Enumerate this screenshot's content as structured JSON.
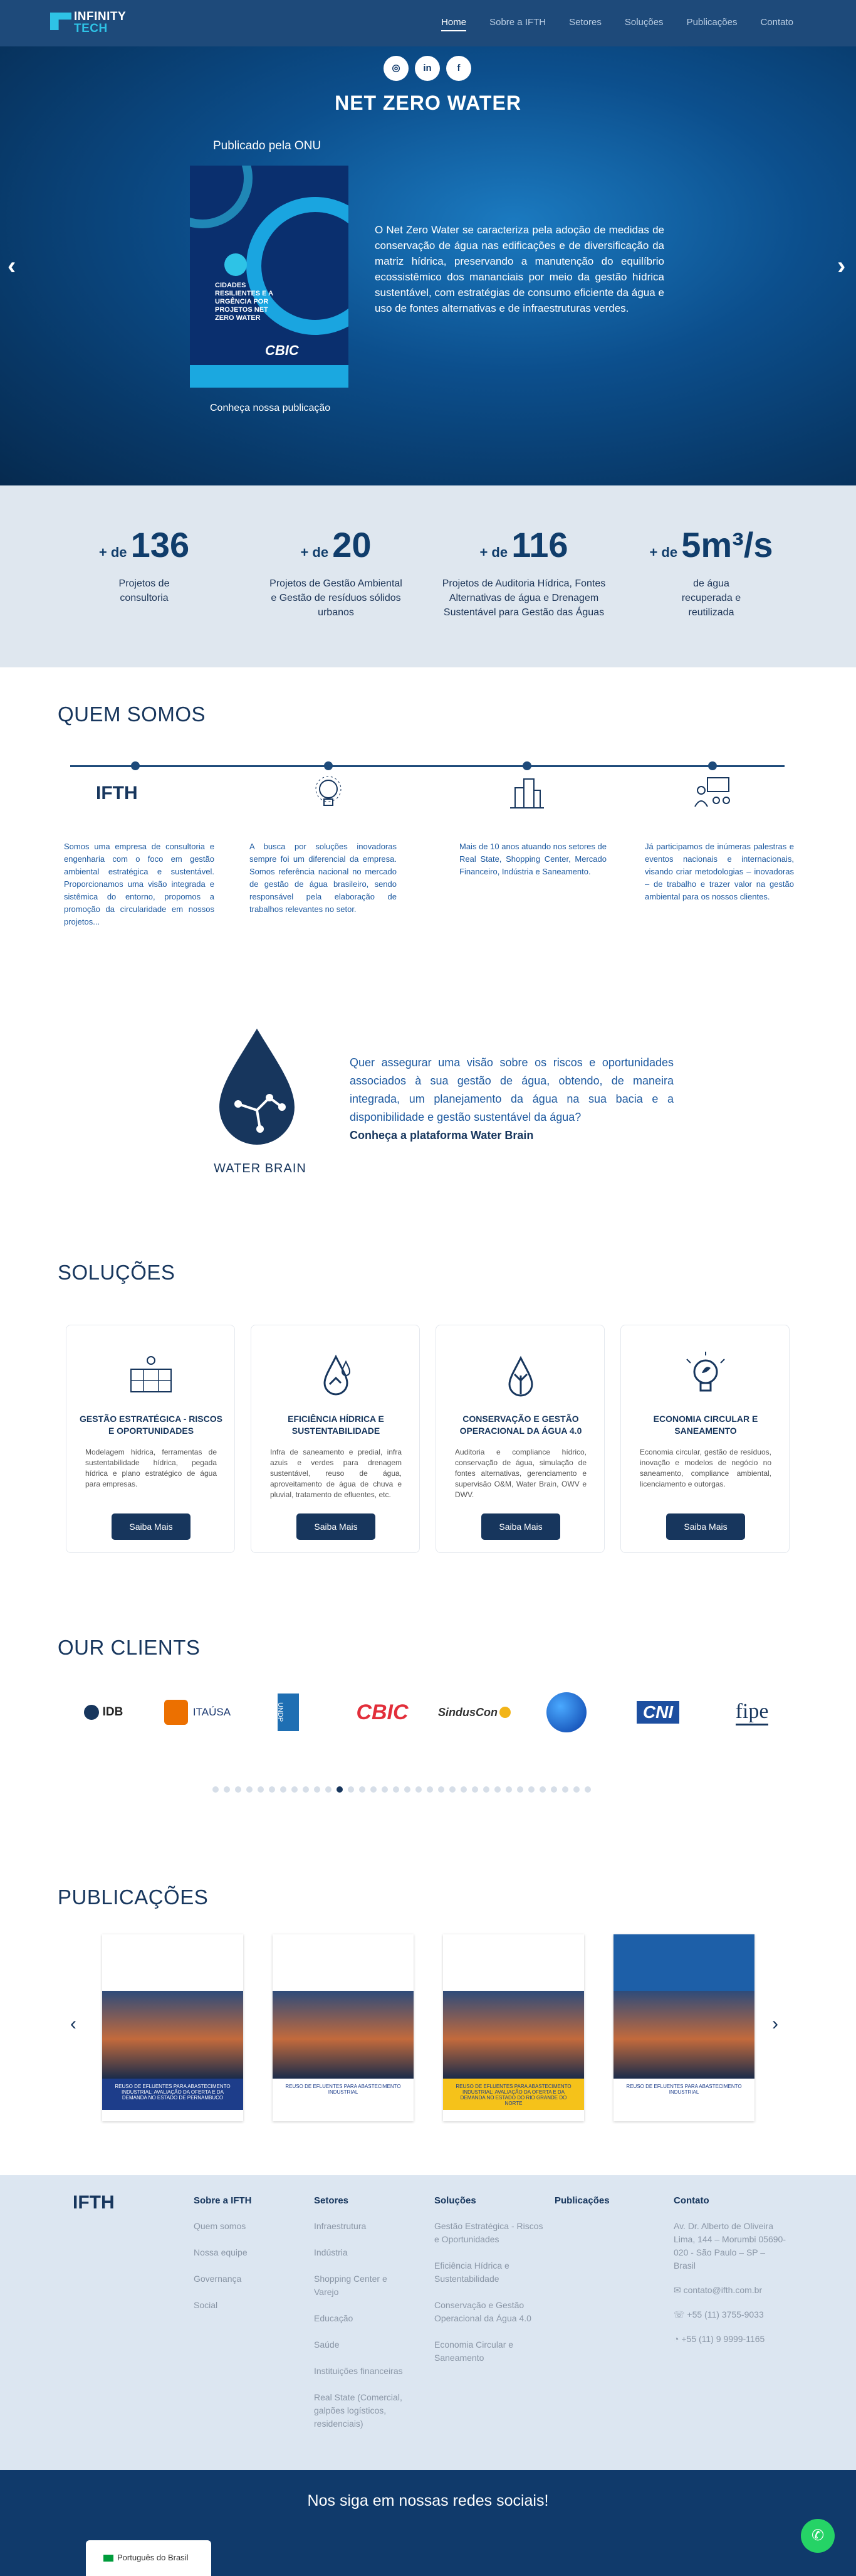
{
  "header": {
    "logo_line1": "INFINITY",
    "logo_line2": "TECH",
    "nav": [
      "Home",
      "Sobre a IFTH",
      "Setores",
      "Soluções",
      "Publicações",
      "Contato"
    ]
  },
  "hero": {
    "title": "NET ZERO WATER",
    "published": "Publicado pela ONU",
    "book_title": "CIDADES RESILIENTES E A URGÊNCIA POR PROJETOS NET ZERO WATER",
    "book_brand": "CBIC",
    "cta": "Conheça nossa publicação",
    "description": "O Net Zero Water se caracteriza pela adoção de medidas de conservação de água nas edificações e de diversificação da matriz hídrica, preservando a manutenção do equilíbrio ecossistêmico dos mananciais por meio da gestão hídrica sustentável, com estratégias de consumo eficiente da água e uso de fontes alternativas e de infraestruturas verdes.",
    "prev": "‹",
    "next": "›"
  },
  "stats": [
    {
      "prefix": "+ de",
      "num": "136",
      "label": "Projetos de consultoria"
    },
    {
      "prefix": "+ de",
      "num": "20",
      "label": "Projetos de Gestão Ambiental e Gestão de resíduos sólidos urbanos"
    },
    {
      "prefix": "+ de",
      "num": "116",
      "label": "Projetos de Auditoria Hídrica, Fontes Alternativas de água e Drenagem Sustentável para Gestão das Águas"
    },
    {
      "prefix": "+ de",
      "num": "5m³/s",
      "label": "de água recuperada e reutilizada"
    }
  ],
  "about": {
    "title": "QUEM SOMOS",
    "logo": "IFTH",
    "items": [
      "Somos uma empresa de consultoria e engenharia com o foco em gestão ambiental estratégica e sustentável. Proporcionamos uma visão integrada e sistêmica do entorno, propomos a promoção da circularidade em nossos projetos...",
      "A busca por soluções inovadoras sempre foi um diferencial da empresa. Somos referência nacional no mercado de gestão de água brasileiro, sendo responsável pela elaboração de trabalhos relevantes no setor.",
      "Mais de 10 anos atuando nos setores de Real State, Shopping Center, Mercado Financeiro, Indústria e Saneamento.",
      "Já participamos de inúmeras palestras e eventos nacionais e internacionais, visando criar metodologias – inovadoras – de trabalho e trazer valor na gestão ambiental para os nossos clientes."
    ]
  },
  "waterbrain": {
    "label": "WATER BRAIN",
    "text": "Quer assegurar uma visão sobre os riscos e oportunidades associados à sua gestão de água, obtendo, de maneira integrada, um planejamento da água na sua bacia e a disponibilidade e gestão sustentável da água?",
    "link": "Conheça a plataforma Water Brain"
  },
  "solutions": {
    "title": "SOLUÇÕES",
    "button": "Saiba Mais",
    "cards": [
      {
        "title": "GESTÃO ESTRATÉGICA - RISCOS E OPORTUNIDADES",
        "desc": "Modelagem hídrica, ferramentas de sustentabilidade hídrica, pegada hídrica e plano estratégico de água para empresas."
      },
      {
        "title": "EFICIÊNCIA HÍDRICA E SUSTENTABILIDADE",
        "desc": "Infra de saneamento e predial, infra azuis e verdes para drenagem sustentável, reuso de água, aproveitamento de água de chuva e pluvial, tratamento de efluentes, etc."
      },
      {
        "title": "CONSERVAÇÃO E GESTÃO OPERACIONAL DA ÁGUA 4.0",
        "desc": "Auditoria e compliance hídrico, conservação de água, simulação de fontes alternativas, gerenciamento e supervisão O&M, Water Brain, OWV e DWV."
      },
      {
        "title": "ECONOMIA CIRCULAR E SANEAMENTO",
        "desc": "Economia circular, gestão de resíduos, inovação e modelos de negócio no saneamento, compliance ambiental, licenciamento e outorgas."
      }
    ]
  },
  "clients": {
    "title": "OUR CLIENTS",
    "logos": [
      "IDB",
      "ITAÚSA",
      "UNDP",
      "CBIC",
      "SindusCon",
      "",
      "CNI",
      "fipe"
    ]
  },
  "publications": {
    "title": "PUBLICAÇÕES",
    "items": [
      "REUSO DE EFLUENTES PARA ABASTECIMENTO INDUSTRIAL: AVALIAÇÃO DA OFERTA E DA DEMANDA NO ESTADO DE PERNAMBUCO",
      "REUSO DE EFLUENTES PARA ABASTECIMENTO INDUSTRIAL",
      "REUSO DE EFLUENTES PARA ABASTECIMENTO INDUSTRIAL: AVALIAÇÃO DA OFERTA E DA DEMANDA NO ESTADO DO RIO GRANDE DO NORTE",
      "REUSO DE EFLUENTES PARA ABASTECIMENTO INDUSTRIAL"
    ]
  },
  "footer": {
    "logo": "IFTH",
    "cols": [
      {
        "h": "Sobre a IFTH",
        "items": [
          "Quem somos",
          "Nossa equipe",
          "Governança",
          "Social"
        ]
      },
      {
        "h": "Setores",
        "items": [
          "Infraestrutura",
          "Indústria",
          "Shopping Center e Varejo",
          "Educação",
          "Saúde",
          "Instituições financeiras",
          "Real State (Comercial, galpões logísticos, residenciais)"
        ]
      },
      {
        "h": "Soluções",
        "items": [
          "Gestão Estratégica - Riscos e Oportunidades",
          "Eficiência Hídrica e Sustentabilidade",
          "Conservação e Gestão Operacional da Água 4.0",
          "Economia Circular e Saneamento"
        ]
      },
      {
        "h": "Publicações",
        "items": []
      }
    ],
    "contact": {
      "h": "Contato",
      "address": "Av. Dr. Alberto de Oliveira Lima, 144 – Morumbi 05690-020 - São Paulo – SP – Brasil",
      "email": "contato@ifth.com.br",
      "phone1": "+55 (11) 3755-9033",
      "phone2": "+55 (11) 9 9999-1165"
    }
  },
  "social": {
    "title": "Nos siga em nossas redes sociais!",
    "icons": [
      "instagram-icon",
      "linkedin-icon",
      "facebook-icon"
    ]
  },
  "language": "Português do Brasil"
}
